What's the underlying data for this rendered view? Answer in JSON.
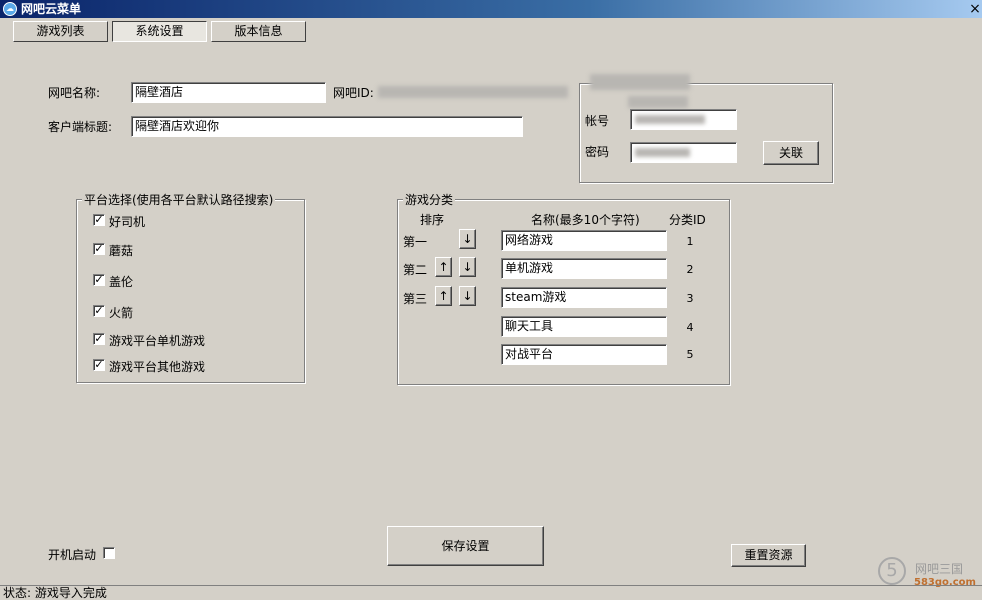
{
  "window": {
    "title": "网吧云菜单",
    "close_glyph": "×"
  },
  "tabs": [
    {
      "label": "游戏列表"
    },
    {
      "label": "系统设置"
    },
    {
      "label": "版本信息"
    }
  ],
  "form": {
    "netcafe_name_label": "网吧名称:",
    "netcafe_name_value": "隔壁酒店",
    "netcafe_id_label": "网吧ID:",
    "client_title_label": "客户端标题:",
    "client_title_value": "隔壁酒店欢迎你"
  },
  "account": {
    "account_label": "帐号",
    "password_label": "密码",
    "link_button": "关联"
  },
  "platform_group": {
    "title": "平台选择(使用各平台默认路径搜索)",
    "check_glyph": "✓",
    "items": [
      {
        "label": "好司机",
        "checked": true
      },
      {
        "label": "蘑菇",
        "checked": true
      },
      {
        "label": "盖伦",
        "checked": true
      },
      {
        "label": "火箭",
        "checked": true
      },
      {
        "label": "游戏平台单机游戏",
        "checked": true
      },
      {
        "label": "游戏平台其他游戏",
        "checked": true
      }
    ]
  },
  "category_group": {
    "title": "游戏分类",
    "order_header": "排序",
    "name_header": "名称(最多10个字符)",
    "id_header": "分类ID",
    "up_glyph": "↑",
    "down_glyph": "↓",
    "order_labels": [
      "第一",
      "第二",
      "第三"
    ],
    "categories": [
      {
        "name": "网络游戏",
        "id": "1"
      },
      {
        "name": "单机游戏",
        "id": "2"
      },
      {
        "name": "steam游戏",
        "id": "3"
      },
      {
        "name": "聊天工具",
        "id": "4"
      },
      {
        "name": "对战平台",
        "id": "5"
      }
    ]
  },
  "bottom": {
    "autostart_label": "开机启动",
    "autostart_checked": false,
    "save_button": "保存设置",
    "reset_button": "重置资源"
  },
  "status": {
    "text": "状态: 游戏导入完成"
  },
  "watermark": {
    "logo_glyph": "5",
    "brand": "网吧三国",
    "domain": "583go.com"
  }
}
